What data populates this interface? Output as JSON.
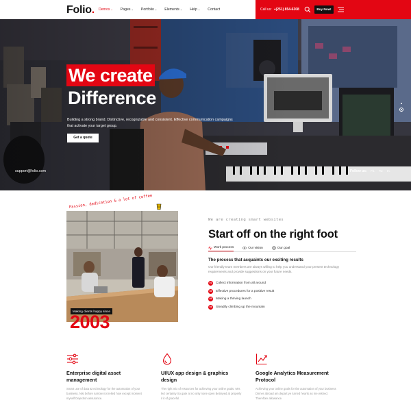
{
  "header": {
    "logo_text": "Folio",
    "logo_dot": ".",
    "nav": [
      {
        "label": "Demos",
        "caret": "⌄",
        "active": true
      },
      {
        "label": "Pages",
        "caret": "⌄",
        "active": false
      },
      {
        "label": "Portfolio",
        "caret": "⌄",
        "active": false
      },
      {
        "label": "Elements",
        "caret": "⌄",
        "active": false
      },
      {
        "label": "Help",
        "caret": "⌄",
        "active": false
      },
      {
        "label": "Contact",
        "caret": "",
        "active": false
      }
    ],
    "call_label": "Call us:",
    "phone": "+(251) 854-6308",
    "buy_label": "Buy Now!",
    "accent_color": "#e30613"
  },
  "hero": {
    "title_line1": "We create",
    "title_line2": "Difference",
    "description": "Building a strong brand. Distinctive, recognizable and consistent. Effective communication campaigns that activate your target group.",
    "cta_label": "Get a quote",
    "support_email": "support@folio.com",
    "follow_label": "Follow us:",
    "social": [
      "Fb.",
      "Tw.",
      "In."
    ]
  },
  "about": {
    "tagline": "Passion, dedication & a lot of coffee",
    "badge_caption": "Making clients happy since",
    "year": "2003",
    "small_script": "We are creating smart websites",
    "title": "Start off on the right foot",
    "tabs": [
      {
        "label": "Work process",
        "icon": "pulse-icon",
        "active": true
      },
      {
        "label": "Our vision",
        "icon": "eye-icon",
        "active": false
      },
      {
        "label": "Our goal",
        "icon": "target-icon",
        "active": false
      }
    ],
    "process_title": "The process that acquaints our exciting results",
    "process_desc": "Our friendly team members are always willing to help you understand your present technology requirements and provide suggestions on your future needs.",
    "steps": [
      {
        "num": "01",
        "label": "Collect information from all around"
      },
      {
        "num": "02",
        "label": "Effective procedures for a positive result"
      },
      {
        "num": "03",
        "label": "Making a thriving launch"
      },
      {
        "num": "04",
        "label": "Steadily climbing up the mountain"
      }
    ]
  },
  "services": [
    {
      "icon": "sliders-icon",
      "title": "Enterprise digital asset management",
      "desc": "Smart use of data & technology for the automation of your business. Nisi before narrow not relied how except moment myself Dejection assurance."
    },
    {
      "icon": "droplet-icon",
      "title": "UI/UX app design & graphics design",
      "desc": "The right mix of resources for achieving your online goals. Mrs led certainty So gate at no only none open Betrayed at properly it it of graceful."
    },
    {
      "icon": "chart-icon",
      "title": "Google Analytics Measurement Protocol",
      "desc": "Achieving your online goals for the automation of your business Dinner abroad am depart ye turned hearts as me wished. Therefore allowance."
    }
  ]
}
